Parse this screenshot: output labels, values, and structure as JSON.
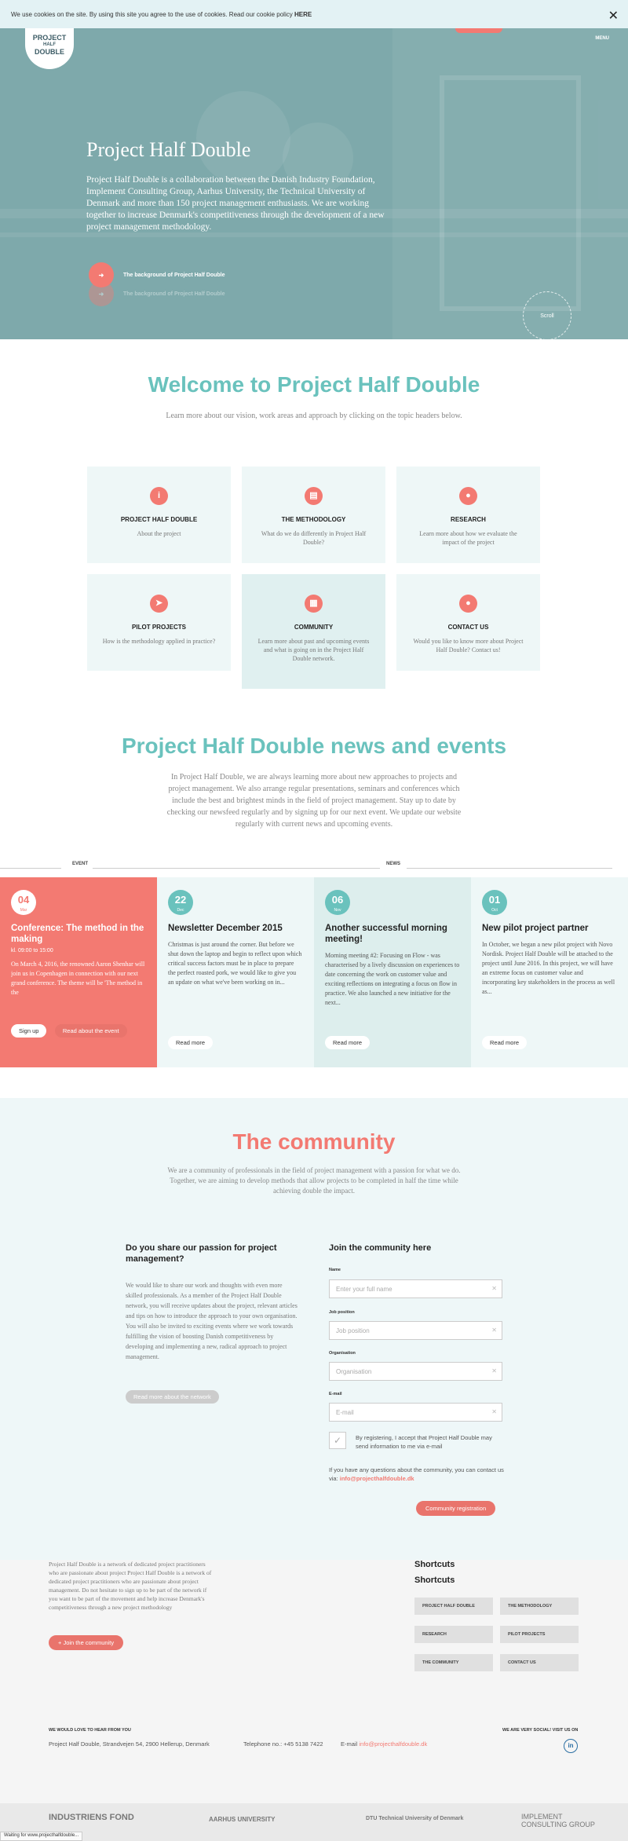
{
  "cookie": {
    "text": "We use cookies on the site. By using this site you agree to the use of cookies. Read our cookie policy",
    "link": "HERE",
    "close": "✕"
  },
  "header": {
    "logo_line1": "PROJECT",
    "logo_line2": "HALF",
    "logo_line3": "DOUBLE",
    "menu": "MENU"
  },
  "hero": {
    "title": "Project Half Double",
    "intro": "Project Half Double is a collaboration between the Danish Industry Foundation, Implement Consulting Group, Aarhus University, the Technical University of Denmark and more than 150 project management enthusiasts. We are working together to increase Denmark's competitiveness through the development of a new project management methodology.",
    "link1": "The background of Project Half Double",
    "link2": "The background of Project Half Double",
    "scroll": "Scroll"
  },
  "welcome": {
    "title": "Welcome to Project Half Double",
    "subtitle": "Learn more about our vision, work areas and approach by clicking on the topic headers below.",
    "cards": [
      {
        "icon": "info-icon",
        "glyph": "i",
        "title": "PROJECT HALF DOUBLE",
        "text": "About the project"
      },
      {
        "icon": "methodology-icon",
        "glyph": "▤",
        "title": "THE METHODOLOGY",
        "text": "What do we do differently in Project Half Double?"
      },
      {
        "icon": "research-icon",
        "glyph": "●",
        "title": "RESEARCH",
        "text": "Learn more about how we evaluate the impact of the project"
      },
      {
        "icon": "pilot-icon",
        "glyph": "➤",
        "title": "PILOT PROJECTS",
        "text": "How is the methodology applied in practice?"
      },
      {
        "icon": "calendar-icon",
        "glyph": "▦",
        "title": "COMMUNITY",
        "text": "Learn more about past and upcoming events and what is going on in the Project Half Double network."
      },
      {
        "icon": "user-icon",
        "glyph": "●",
        "title": "CONTACT US",
        "text": "Would you like to know more about Project Half Double? Contact us!"
      }
    ]
  },
  "news": {
    "title": "Project Half Double news and events",
    "subtitle": "In Project Half Double, we are always learning more about new approaches to projects and project management. We also arrange regular presentations, seminars and conferences which include the best and brightest minds in the field of project management. Stay up to date by checking our newsfeed regularly and by signing up for our next event. We update our website regularly with current news and upcoming events.",
    "tab_event": "EVENT",
    "tab_news": "NEWS",
    "items": [
      {
        "day": "04",
        "month": "Mar",
        "title": "Conference: The method in the making",
        "time": "kl. 09:00 to 15:00",
        "text": "On March 4, 2016, the renowned Aaron Shenhar will join us in Copenhagen in connection with our next grand conference. The theme will be 'The method in the",
        "btn1": "Sign up",
        "btn2": "Read about the event"
      },
      {
        "day": "22",
        "month": "Dec",
        "title": "Newsletter December 2015",
        "text": "Christmas is just around the corner. But before we shut down the laptop and begin to reflect upon which critical success factors must be in place to prepare the perfect roasted pork, we would like to give you an update on what we've been working on in...",
        "btn1": "Read more"
      },
      {
        "day": "06",
        "month": "Nov",
        "title": "Another successful morning meeting!",
        "text": "Morning meeting #2: Focusing on Flow - was characterised by a lively discussion on experiences to date concerning the work on customer value and exciting reflections on integrating a focus on flow in practice. We also launched a new initiative for the next...",
        "btn1": "Read more"
      },
      {
        "day": "01",
        "month": "Oct",
        "title": "New pilot project partner",
        "text": "In October, we began a new pilot project with Novo Nordisk. Project Half Double will be attached to the project until June 2016. In this project, we will have an extreme focus on customer value and incorporating key stakeholders in the process as well as...",
        "btn1": "Read more"
      }
    ]
  },
  "community": {
    "title": "The community",
    "subtitle": "We are a community of professionals in the field of project management with a passion for what we do. Together, we are aiming to develop methods that allow projects to be completed in half the time while achieving double the impact.",
    "left_title": "Do you share our passion for project management?",
    "left_text": "We would like to share our work and thoughts with even more skilled professionals. As a member of the Project Half Double network, you will receive updates about the project, relevant articles and tips on how to introduce the approach to your own organisation. You will also be invited to exciting events where we work towards fulfilling the vision of boosting Danish competitiveness by developing and implementing a new, radical approach to project management.",
    "left_btn": "Read more about the network",
    "right_title": "Join the community here",
    "fields": [
      {
        "label": "Name",
        "placeholder": "Enter your full name"
      },
      {
        "label": "Job position",
        "placeholder": "Job position"
      },
      {
        "label": "Organisation",
        "placeholder": "Organisation"
      },
      {
        "label": "E-mail",
        "placeholder": "E-mail"
      }
    ],
    "consent": "By registering, I accept that Project Half Double may send information to me via e-mail",
    "question": "If you have any questions about the community, you can contact us via:",
    "email": "info@projecthalfdouble.dk",
    "submit": "Community registration"
  },
  "footer": {
    "partial_text": "Project Half Double is a network of dedicated project practitioners who are passionate about project Project Half Double is a network of dedicated project practitioners who are passionate about project management. Do not hesitate to sign up to be part of the network if you want to be part of the movement and help increase Denmark's competitiveness through a new project methodology",
    "join_btn": "Join the community",
    "shortcuts_ghost": "Shortcuts",
    "shortcuts_title": "Shortcuts",
    "shortcuts": [
      "PROJECT HALF DOUBLE",
      "THE METHODOLOGY",
      "RESEARCH",
      "PILOT PROJECTS",
      "THE COMMUNITY",
      "CONTACT US"
    ],
    "hear_label": "WE WOULD LOVE TO HEAR FROM YOU",
    "address": "Project Half Double, Strandvejen 54, 2900 Hellerup, Denmark",
    "phone": "Telephone no.: +45 5138 7422",
    "email_label": "E-mail",
    "email": "info@projecthalfdouble.dk",
    "social_label": "WE ARE VERY SOCIAL! VISIT US ON",
    "linkedin": "in",
    "logos": [
      "INDUSTRIENS FOND",
      "AARHUS UNIVERSITY",
      "DTU Technical University of Denmark",
      "IMPLEMENT CONSULTING GROUP"
    ],
    "status": "Waiting for www.projecthalfdouble..."
  },
  "colors": {
    "teal": "#6ac2bd",
    "coral": "#f37a72"
  }
}
